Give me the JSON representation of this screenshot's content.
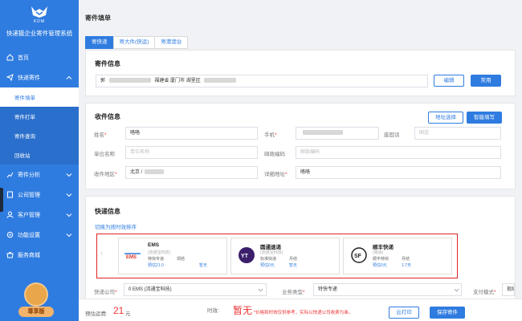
{
  "sidebar": {
    "logo_text": "KDM",
    "system_title": "快递猫企业寄件管理系统",
    "items": [
      {
        "label": "首页"
      },
      {
        "label": "快递寄件"
      },
      {
        "label": "寄件分析"
      },
      {
        "label": "公司管理"
      },
      {
        "label": "客户管理"
      },
      {
        "label": "功能设置"
      },
      {
        "label": "服务商城"
      }
    ],
    "sub_items": [
      {
        "label": "寄件填单"
      },
      {
        "label": "寄件打单"
      },
      {
        "label": "寄件查询"
      },
      {
        "label": "回收站"
      }
    ],
    "vip_label": "尊享版"
  },
  "page": {
    "title": "寄件填单",
    "tabs": [
      "寄快递",
      "寄大件(快运)",
      "寄港澳台"
    ]
  },
  "sender": {
    "title": "寄件信息",
    "prefix": "郭",
    "address": "福建省 厦门市 湖里区",
    "edit_button": "编辑",
    "common_button": "常用"
  },
  "receiver": {
    "title": "收件信息",
    "select_button": "地址选择",
    "smart_button": "智能填写",
    "name_label": "姓名",
    "name_value": "咯咯",
    "phone_label": "手机",
    "landline_label": "座固话",
    "landline_placeholder": "固话",
    "company_label": "单位名称",
    "company_placeholder": "单位名称",
    "postcode_label": "邮政编码",
    "postcode_placeholder": "邮政编码",
    "region_label": "收件地区",
    "region_value": "北京 /",
    "detail_label": "详细地址",
    "detail_value": "咯咯"
  },
  "express": {
    "title": "快递信息",
    "switch_link": "切换为按时效排序",
    "carriers": [
      {
        "name": "EMS",
        "sub": "(流通宝科技)",
        "type": "特快专递",
        "settle": "现结",
        "price": "预估21.0",
        "eta": "暂无",
        "logo": "ems-logo"
      },
      {
        "name": "圆通速递",
        "sub": "(流通宝科技)",
        "type": "标准快递",
        "settle": "月结",
        "price": "预估0元",
        "eta": "暂无",
        "logo": "yto-logo"
      },
      {
        "name": "顺丰快递",
        "sub": "(简适)",
        "type": "顺丰特快",
        "settle": "月结",
        "price": "预估0元",
        "eta": "1.7天",
        "logo": "sf-logo"
      }
    ],
    "company_label": "快递公司",
    "company_value": "0 EMS (流通宝科技)",
    "service_label": "业务类型",
    "service_value": "特快专递",
    "pay_label": "支付模式",
    "pay_value": "现结"
  },
  "footer": {
    "est_label": "预估运费:",
    "est_value": "21",
    "est_unit": "元",
    "time_label": "时效:",
    "time_value": "暂无",
    "note": "*价格和时效仅供参考，实际以快递公司收费为准。",
    "print_button": "云打印",
    "save_button": "保存寄件"
  },
  "colors": {
    "brand": "#2f7ce0",
    "highlight_border": "#e02424",
    "price_red": "#e33"
  }
}
